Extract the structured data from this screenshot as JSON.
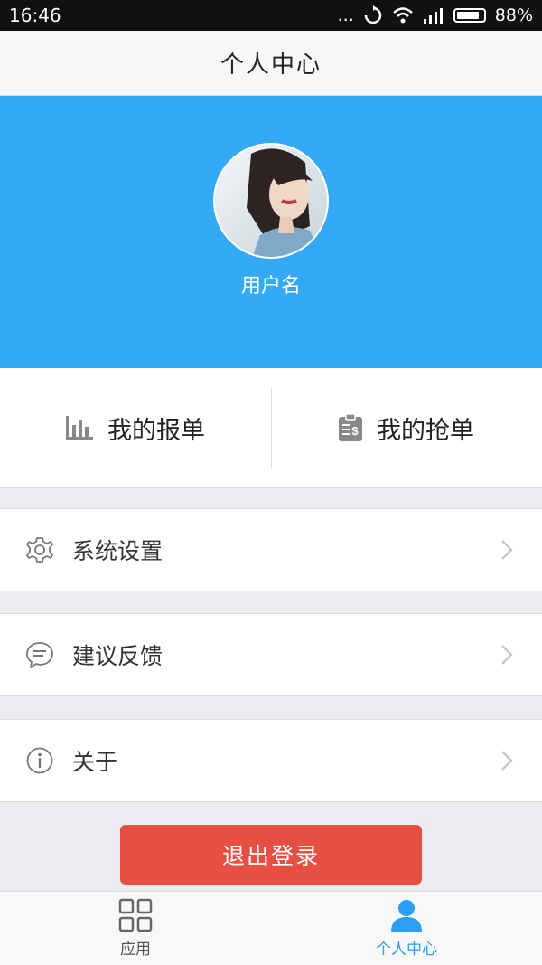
{
  "status_bar": {
    "time": "16:46",
    "dots": "...",
    "battery_percent": "88%"
  },
  "nav": {
    "title": "个人中心"
  },
  "profile": {
    "username": "用户名"
  },
  "orders": {
    "my_reports": "我的报单",
    "my_grabs": "我的抢单"
  },
  "menu": {
    "settings": "系统设置",
    "feedback": "建议反馈",
    "about": "关于"
  },
  "logout": {
    "label": "退出登录"
  },
  "tabs": [
    {
      "label": "应用",
      "active": false
    },
    {
      "label": "个人中心",
      "active": true
    }
  ],
  "colors": {
    "accent": "#33a9f8",
    "logout": "#e84f43",
    "active_tab": "#2a9ff3"
  }
}
